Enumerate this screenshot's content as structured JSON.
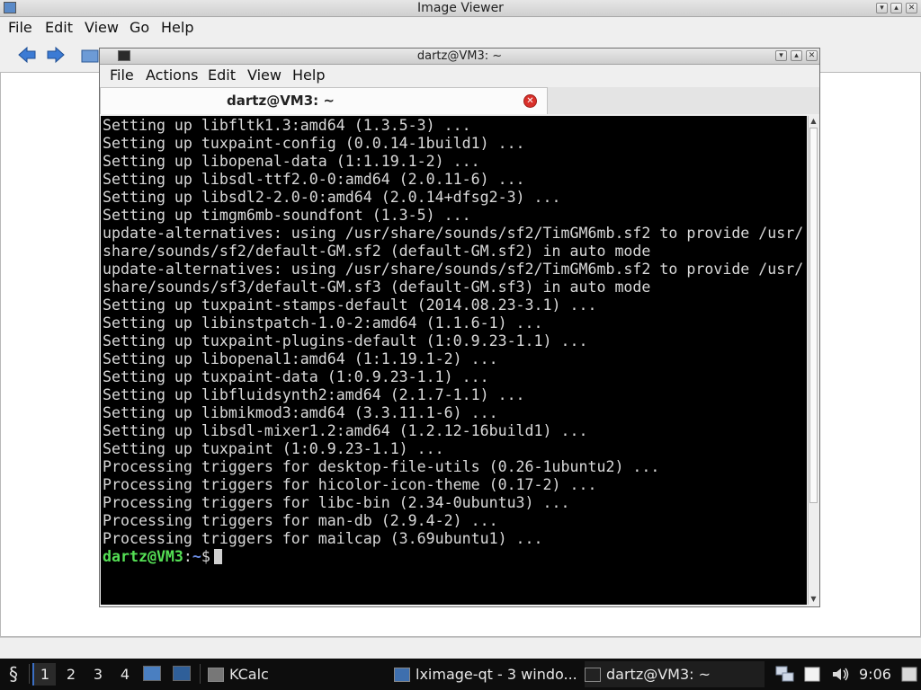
{
  "image_viewer": {
    "title": "Image Viewer",
    "menu": [
      "File",
      "Edit",
      "View",
      "Go",
      "Help"
    ],
    "controls": {
      "minimize": "▾",
      "maximize": "▴",
      "close": "✕"
    }
  },
  "terminal": {
    "title": "dartz@VM3: ~",
    "menu": [
      "File",
      "Actions",
      "Edit",
      "View",
      "Help"
    ],
    "tab_label": "dartz@VM3: ~",
    "lines": [
      "Setting up libfltk1.3:amd64 (1.3.5-3) ...",
      "Setting up tuxpaint-config (0.0.14-1build1) ...",
      "Setting up libopenal-data (1:1.19.1-2) ...",
      "Setting up libsdl-ttf2.0-0:amd64 (2.0.11-6) ...",
      "Setting up libsdl2-2.0-0:amd64 (2.0.14+dfsg2-3) ...",
      "Setting up timgm6mb-soundfont (1.3-5) ...",
      "update-alternatives: using /usr/share/sounds/sf2/TimGM6mb.sf2 to provide /usr/",
      "share/sounds/sf2/default-GM.sf2 (default-GM.sf2) in auto mode",
      "update-alternatives: using /usr/share/sounds/sf2/TimGM6mb.sf2 to provide /usr/",
      "share/sounds/sf3/default-GM.sf3 (default-GM.sf3) in auto mode",
      "Setting up tuxpaint-stamps-default (2014.08.23-3.1) ...",
      "Setting up libinstpatch-1.0-2:amd64 (1.1.6-1) ...",
      "Setting up tuxpaint-plugins-default (1:0.9.23-1.1) ...",
      "Setting up libopenal1:amd64 (1:1.19.1-2) ...",
      "Setting up tuxpaint-data (1:0.9.23-1.1) ...",
      "Setting up libfluidsynth2:amd64 (2.1.7-1.1) ...",
      "Setting up libmikmod3:amd64 (3.3.11.1-6) ...",
      "Setting up libsdl-mixer1.2:amd64 (1.2.12-16build1) ...",
      "Setting up tuxpaint (1:0.9.23-1.1) ...",
      "Processing triggers for desktop-file-utils (0.26-1ubuntu2) ...",
      "Processing triggers for hicolor-icon-theme (0.17-2) ...",
      "Processing triggers for libc-bin (2.34-0ubuntu3) ...",
      "Processing triggers for man-db (2.9.4-2) ...",
      "Processing triggers for mailcap (3.69ubuntu1) ..."
    ],
    "prompt": {
      "user_host": "dartz@VM3",
      "sep": ":",
      "path": "~",
      "symbol": "$"
    }
  },
  "taskbar": {
    "desktops": [
      "1",
      "2",
      "3",
      "4"
    ],
    "tasks": [
      {
        "label": "KCalc",
        "icon": "calculator-icon"
      },
      {
        "label": "lximage-qt - 3 windo...",
        "icon": "image-icon"
      },
      {
        "label": "dartz@VM3: ~",
        "icon": "terminal-icon"
      }
    ],
    "clock": "9:06"
  },
  "colors": {
    "terminal_bg": "#000000",
    "terminal_fg": "#d9d9d9",
    "prompt_user": "#55e055",
    "prompt_path": "#6c8fe8",
    "taskbar_bg": "#0d0d0d",
    "close_red": "#d9302a"
  }
}
